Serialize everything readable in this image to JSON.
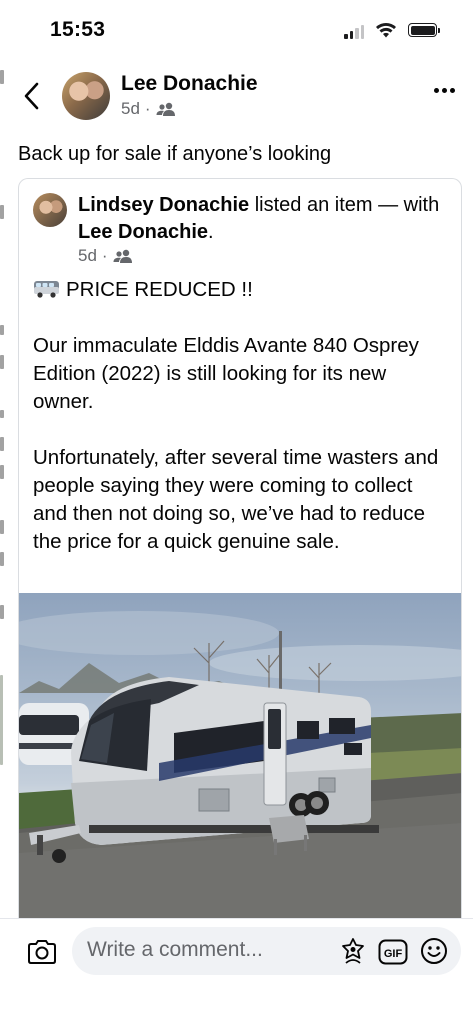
{
  "status_bar": {
    "time": "15:53"
  },
  "header": {
    "author": "Lee Donachie",
    "timestamp": "5d",
    "separator": "·",
    "audience_icon": "friends-icon"
  },
  "post": {
    "text": "Back up for sale if anyone’s looking"
  },
  "shared_post": {
    "author": "Lindsey Donachie",
    "action": " listed an item — with ",
    "tagged": "Lee Donachie",
    "end": ".",
    "timestamp": "5d",
    "separator": "·",
    "headline": "PRICE REDUCED !!",
    "paragraph_1": "Our immaculate Elddis Avante 840 Osprey Edition (2022) is still looking for its new owner.",
    "paragraph_2": "Unfortunately, after several time wasters and people saying they were coming to collect and then not doing so, we’ve had to reduce the price for a quick genuine sale."
  },
  "comment_bar": {
    "placeholder": "Write a comment...",
    "icons": [
      "camera-icon",
      "avatar-sticker-icon",
      "gif-icon",
      "emoji-icon"
    ]
  },
  "colors": {
    "text": "#050505",
    "secondary": "#65676b",
    "input_bg": "#f0f2f5"
  }
}
